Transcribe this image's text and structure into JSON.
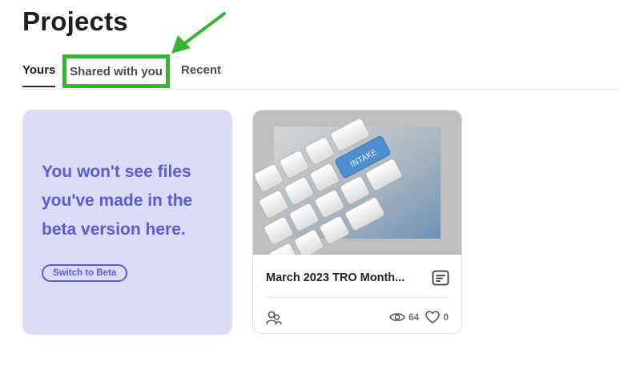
{
  "page": {
    "title": "Projects"
  },
  "tabs": [
    {
      "label": "Yours",
      "active": true
    },
    {
      "label": "Shared with you",
      "active": false
    },
    {
      "label": "Recent",
      "active": false
    }
  ],
  "beta_card": {
    "message": "You won't see files you've made in the beta version here.",
    "button_label": "Switch to Beta"
  },
  "project": {
    "title": "March 2023 TRO Month...",
    "thumbnail_key_label": "INTAKE",
    "views": "64",
    "likes": "0"
  },
  "icons": [
    "doc-icon",
    "people-icon",
    "eye-icon",
    "heart-icon",
    "arrow-annotation"
  ],
  "colors": {
    "accent_purple": "#5b5bd6",
    "beta_card_bg": "#dcdcf6",
    "highlight_green": "#36b333"
  }
}
